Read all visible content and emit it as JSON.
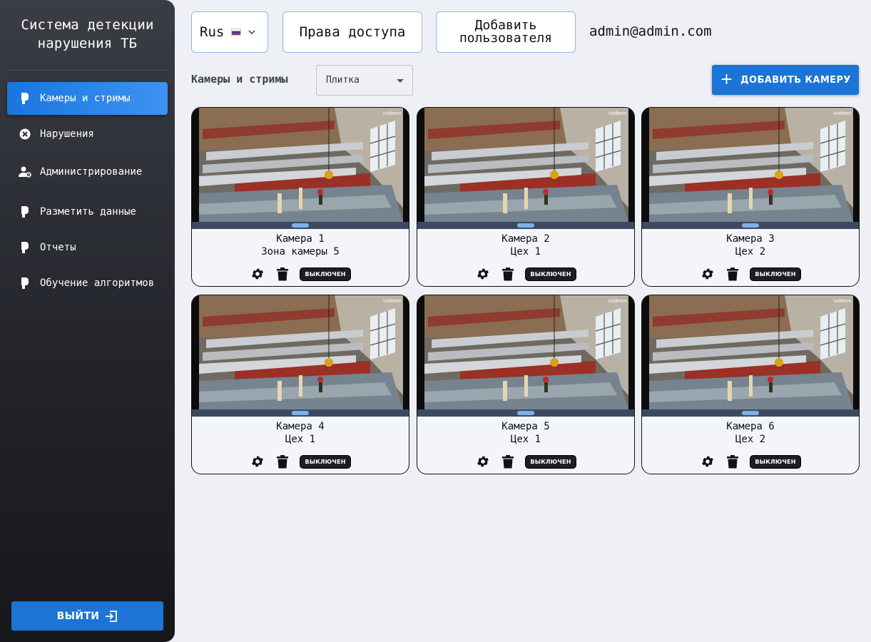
{
  "sidebar": {
    "app_title": "Система детекции\nнарушения ТБ",
    "items": [
      {
        "label": "Камеры и стримы",
        "icon": "camera-icon",
        "active": true
      },
      {
        "label": "Нарушения",
        "icon": "close-circle-icon",
        "active": false
      },
      {
        "label": "Администрирование",
        "icon": "user-settings-icon",
        "active": false
      },
      {
        "label": "Разметить данные",
        "icon": "camera-icon",
        "active": false
      },
      {
        "label": "Отчеты",
        "icon": "camera-icon",
        "active": false
      },
      {
        "label": "Обучение алгоритмов",
        "icon": "camera-icon",
        "active": false
      }
    ],
    "logout_label": "ВЫЙТИ",
    "logout_icon": "logout-icon"
  },
  "header": {
    "language": "Rus",
    "language_flag": "russia-flag-icon",
    "rights_label": "Права доступа",
    "add_user_label": "Добавить\nпользователя",
    "user_email": "admin@admin.com"
  },
  "toolbar": {
    "section_title": "Камеры и стримы",
    "view_mode": "Плитка",
    "add_camera_label": "ДОБАВИТЬ КАМЕРУ"
  },
  "cameras": [
    {
      "name": "Камера 1",
      "zone": "Зона камеры 5",
      "status": "ВЫКЛЮЧЕН"
    },
    {
      "name": "Камера 2",
      "zone": "Цех 1",
      "status": "ВЫКЛЮЧЕН"
    },
    {
      "name": "Камера 3",
      "zone": "Цех 2",
      "status": "ВЫКЛЮЧЕН"
    },
    {
      "name": "Камера 4",
      "zone": "Цех 1",
      "status": "ВЫКЛЮЧЕН"
    },
    {
      "name": "Камера 5",
      "zone": "Цех 1",
      "status": "ВЫКЛЮЧЕН"
    },
    {
      "name": "Камера 6",
      "zone": "Цех 2",
      "status": "ВЫКЛЮЧЕН"
    }
  ],
  "colors": {
    "accent": "#1b74d6",
    "sidebar_bg": "#23252b",
    "page_bg": "#eef0f6",
    "badge_bg": "#1d1e22"
  }
}
